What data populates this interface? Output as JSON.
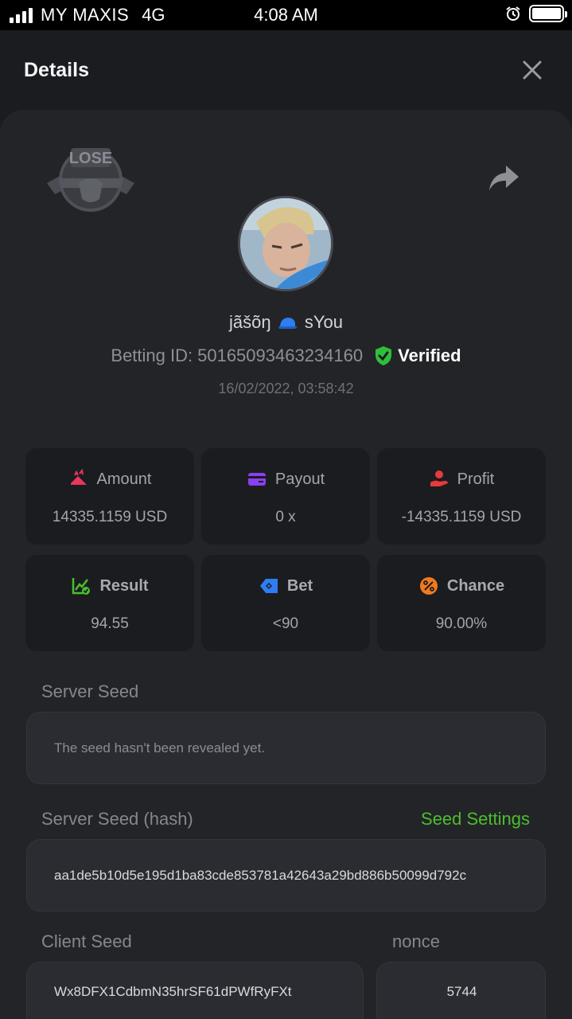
{
  "status_bar": {
    "carrier": "MY MAXIS",
    "network": "4G",
    "time": "4:08 AM"
  },
  "header": {
    "title": "Details",
    "close_icon": "close-icon"
  },
  "bet": {
    "result_badge": "LOSE",
    "username_part1": "jãšõŋ",
    "username_part2": "sYou",
    "betting_id_label": "Betting ID:",
    "betting_id": "50165093463234160",
    "verified_label": "Verified",
    "datetime": "16/02/2022, 03:58:42"
  },
  "stats": [
    {
      "label": "Amount",
      "value": "14335.1159 USD",
      "icon": "amount-icon",
      "color": "#e8375a"
    },
    {
      "label": "Payout",
      "value": "0 x",
      "icon": "payout-icon",
      "color": "#8b3ff0"
    },
    {
      "label": "Profit",
      "value": "-14335.1159 USD",
      "icon": "profit-icon",
      "color": "#e83a3a"
    },
    {
      "label": "Result",
      "value": "94.55",
      "icon": "result-icon",
      "color": "#4bbf2a"
    },
    {
      "label": "Bet",
      "value": "<90",
      "icon": "bet-icon",
      "color": "#2f7df0"
    },
    {
      "label": "Chance",
      "value": "90.00%",
      "icon": "chance-icon",
      "color": "#f07a1e"
    }
  ],
  "server_seed": {
    "label": "Server Seed",
    "value": "The seed hasn't been revealed yet."
  },
  "server_seed_hash": {
    "label": "Server Seed (hash)",
    "link": "Seed Settings",
    "value": "aa1de5b10d5e195d1ba83cde853781a42643a29bd886b50099d792c"
  },
  "client_seed": {
    "label": "Client Seed",
    "value": "Wx8DFX1CdbmN35hrSF61dPWfRyFXt"
  },
  "nonce": {
    "label": "nonce",
    "value": "5744"
  },
  "colors": {
    "accent_green": "#4bbf2a",
    "background": "#1b1c20",
    "card": "#232428"
  }
}
